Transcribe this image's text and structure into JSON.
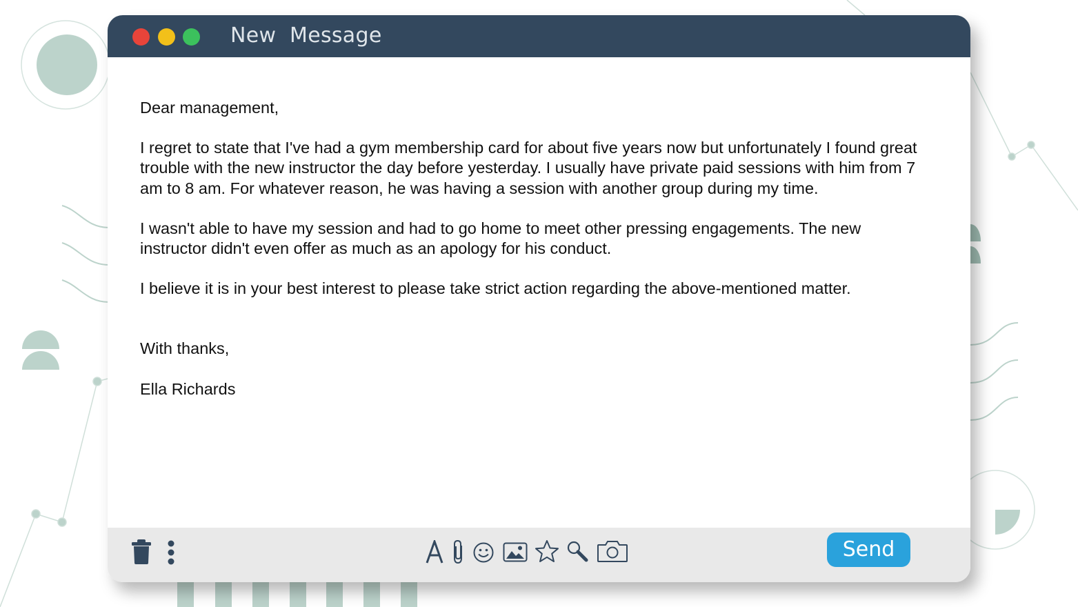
{
  "window": {
    "title": "New  Message",
    "controls": [
      "close",
      "minimize",
      "maximize"
    ]
  },
  "email": {
    "greeting": "Dear management,",
    "paragraphs": [
      "I regret to state that I've had a gym membership card for about five years now but unfortunately I found great trouble with the new instructor the day before yesterday. I usually have private paid sessions with him from 7 am to 8 am. For whatever reason, he was having a session with another group during my time.",
      "I wasn't able to have my session and had to go home to meet other pressing engagements. The new instructor didn't even offer as much as an apology for his conduct.",
      "I believe it is in your best interest to please take strict action regarding the above-mentioned matter."
    ],
    "closing": "With thanks,",
    "signature": "Ella Richards"
  },
  "toolbar": {
    "left_icons": [
      "trash-icon",
      "more-options-icon"
    ],
    "format_icons": [
      "text-format-icon",
      "attachment-icon",
      "emoji-icon",
      "image-icon",
      "star-icon",
      "search-icon",
      "camera-icon"
    ],
    "send_label": "Send"
  },
  "colors": {
    "titlebar": "#33485e",
    "close": "#e8443a",
    "minimize": "#f2c01a",
    "maximize": "#3cc15d",
    "toolbar": "#e9e9e9",
    "send": "#2aa2dc",
    "icon": "#33485e",
    "decor": "#bcd3cb"
  }
}
